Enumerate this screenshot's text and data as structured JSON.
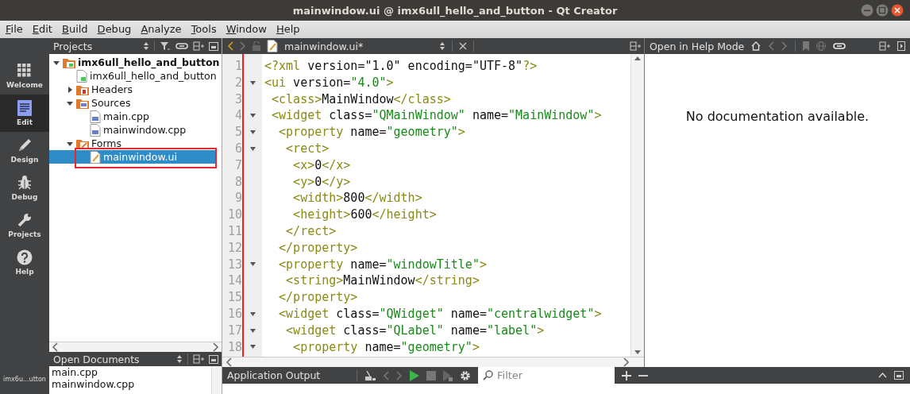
{
  "window": {
    "title": "mainwindow.ui @ imx6ull_hello_and_button - Qt Creator"
  },
  "menu": [
    "File",
    "Edit",
    "Build",
    "Debug",
    "Analyze",
    "Tools",
    "Window",
    "Help"
  ],
  "modes": [
    {
      "label": "Welcome",
      "kind": "welcome",
      "selected": false
    },
    {
      "label": "Edit",
      "kind": "edit",
      "selected": true
    },
    {
      "label": "Design",
      "kind": "design",
      "selected": false
    },
    {
      "label": "Debug",
      "kind": "debug",
      "selected": false
    },
    {
      "label": "Projects",
      "kind": "projects",
      "selected": false
    },
    {
      "label": "Help",
      "kind": "help",
      "selected": false
    }
  ],
  "mode_footer": "imx6u...utton",
  "projects": {
    "title": "Projects",
    "tree": [
      {
        "label": "imx6ull_hello_and_button",
        "kind": "project",
        "expanded": true,
        "selected": false,
        "annotated": false,
        "children": [
          {
            "label": "imx6ull_hello_and_button",
            "kind": "pro",
            "selected": false,
            "annotated": false
          },
          {
            "label": "Headers",
            "kind": "headers",
            "expanded": false,
            "selected": false,
            "annotated": false
          },
          {
            "label": "Sources",
            "kind": "sources",
            "expanded": true,
            "selected": false,
            "annotated": false,
            "children": [
              {
                "label": "main.cpp",
                "kind": "cpp",
                "selected": false,
                "annotated": false
              },
              {
                "label": "mainwindow.cpp",
                "kind": "cpp",
                "selected": false,
                "annotated": false
              }
            ]
          },
          {
            "label": "Forms",
            "kind": "forms",
            "expanded": true,
            "selected": false,
            "annotated": false,
            "children": [
              {
                "label": "mainwindow.ui",
                "kind": "ui",
                "selected": true,
                "annotated": true
              }
            ]
          }
        ]
      }
    ]
  },
  "open_documents": {
    "title": "Open Documents",
    "items": [
      "main.cpp",
      "mainwindow.cpp"
    ]
  },
  "editor": {
    "file": "mainwindow.ui*",
    "lines": [
      {
        "number": "1",
        "foldable": false,
        "tokens": [
          {
            "kind": "tag",
            "text": "<?xml"
          },
          {
            "kind": "plain",
            "text": " version=\"1.0\" encoding=\"UTF-8\""
          },
          {
            "kind": "tag",
            "text": "?>"
          }
        ]
      },
      {
        "number": "2",
        "foldable": true,
        "tokens": [
          {
            "kind": "tag",
            "text": "<ui"
          },
          {
            "kind": "plain",
            "text": " version="
          },
          {
            "kind": "string",
            "text": "\"4.0\""
          },
          {
            "kind": "tag",
            "text": ">"
          }
        ]
      },
      {
        "number": "3",
        "foldable": false,
        "tokens": [
          {
            "kind": "tag",
            "text": " <class>"
          },
          {
            "kind": "plain",
            "text": "MainWindow"
          },
          {
            "kind": "tag",
            "text": "</class>"
          }
        ]
      },
      {
        "number": "4",
        "foldable": true,
        "tokens": [
          {
            "kind": "tag",
            "text": " <widget"
          },
          {
            "kind": "plain",
            "text": " class="
          },
          {
            "kind": "string",
            "text": "\"QMainWindow\""
          },
          {
            "kind": "plain",
            "text": " name="
          },
          {
            "kind": "string",
            "text": "\"MainWindow\""
          },
          {
            "kind": "tag",
            "text": ">"
          }
        ]
      },
      {
        "number": "5",
        "foldable": true,
        "tokens": [
          {
            "kind": "tag",
            "text": "  <property"
          },
          {
            "kind": "plain",
            "text": " name="
          },
          {
            "kind": "string",
            "text": "\"geometry\""
          },
          {
            "kind": "tag",
            "text": ">"
          }
        ]
      },
      {
        "number": "6",
        "foldable": true,
        "tokens": [
          {
            "kind": "tag",
            "text": "   <rect>"
          }
        ]
      },
      {
        "number": "7",
        "foldable": false,
        "tokens": [
          {
            "kind": "tag",
            "text": "    <x>"
          },
          {
            "kind": "plain",
            "text": "0"
          },
          {
            "kind": "tag",
            "text": "</x>"
          }
        ]
      },
      {
        "number": "8",
        "foldable": false,
        "tokens": [
          {
            "kind": "tag",
            "text": "    <y>"
          },
          {
            "kind": "plain",
            "text": "0"
          },
          {
            "kind": "tag",
            "text": "</y>"
          }
        ]
      },
      {
        "number": "9",
        "foldable": false,
        "tokens": [
          {
            "kind": "tag",
            "text": "    <width>"
          },
          {
            "kind": "plain",
            "text": "800"
          },
          {
            "kind": "tag",
            "text": "</width>"
          }
        ]
      },
      {
        "number": "10",
        "foldable": false,
        "tokens": [
          {
            "kind": "tag",
            "text": "    <height>"
          },
          {
            "kind": "plain",
            "text": "600"
          },
          {
            "kind": "tag",
            "text": "</height>"
          }
        ]
      },
      {
        "number": "11",
        "foldable": false,
        "tokens": [
          {
            "kind": "tag",
            "text": "   </rect>"
          }
        ]
      },
      {
        "number": "12",
        "foldable": false,
        "tokens": [
          {
            "kind": "tag",
            "text": "  </property>"
          }
        ]
      },
      {
        "number": "13",
        "foldable": true,
        "tokens": [
          {
            "kind": "tag",
            "text": "  <property"
          },
          {
            "kind": "plain",
            "text": " name="
          },
          {
            "kind": "string",
            "text": "\"windowTitle\""
          },
          {
            "kind": "tag",
            "text": ">"
          }
        ]
      },
      {
        "number": "14",
        "foldable": false,
        "tokens": [
          {
            "kind": "tag",
            "text": "   <string>"
          },
          {
            "kind": "plain",
            "text": "MainWindow"
          },
          {
            "kind": "tag",
            "text": "</string>"
          }
        ]
      },
      {
        "number": "15",
        "foldable": false,
        "tokens": [
          {
            "kind": "tag",
            "text": "  </property>"
          }
        ]
      },
      {
        "number": "16",
        "foldable": true,
        "tokens": [
          {
            "kind": "tag",
            "text": "  <widget"
          },
          {
            "kind": "plain",
            "text": " class="
          },
          {
            "kind": "string",
            "text": "\"QWidget\""
          },
          {
            "kind": "plain",
            "text": " name="
          },
          {
            "kind": "string",
            "text": "\"centralwidget\""
          },
          {
            "kind": "tag",
            "text": ">"
          }
        ]
      },
      {
        "number": "17",
        "foldable": true,
        "tokens": [
          {
            "kind": "tag",
            "text": "   <widget"
          },
          {
            "kind": "plain",
            "text": " class="
          },
          {
            "kind": "string",
            "text": "\"QLabel\""
          },
          {
            "kind": "plain",
            "text": " name="
          },
          {
            "kind": "string",
            "text": "\"label\""
          },
          {
            "kind": "tag",
            "text": ">"
          }
        ]
      },
      {
        "number": "18",
        "foldable": true,
        "tokens": [
          {
            "kind": "tag",
            "text": "    <property"
          },
          {
            "kind": "plain",
            "text": " name="
          },
          {
            "kind": "string",
            "text": "\"geometry\""
          },
          {
            "kind": "tag",
            "text": ">"
          }
        ]
      }
    ]
  },
  "help": {
    "title": "Open in Help Mode",
    "message": "No documentation available."
  },
  "output": {
    "title": "Application Output",
    "filter_placeholder": "Filter"
  }
}
